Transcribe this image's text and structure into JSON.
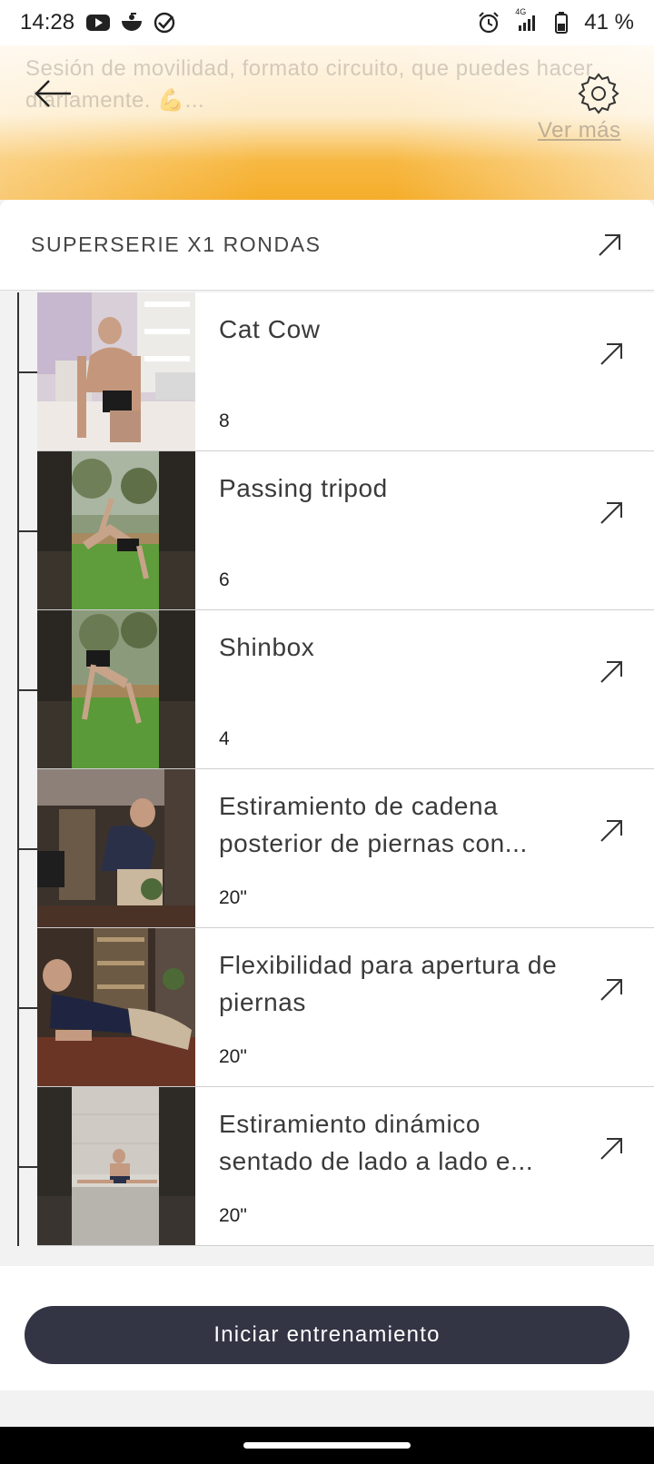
{
  "status_bar": {
    "time": "14:28",
    "network": "4G",
    "battery": "41 %",
    "icons": [
      "youtube-icon",
      "app-bowl-icon",
      "check-circle-icon",
      "alarm-icon",
      "signal-icon",
      "battery-icon"
    ]
  },
  "header": {
    "description": "Sesión de movilidad, formato circuito, que puedes hacer diariamente. 💪...",
    "see_more": "Ver más",
    "colors": {
      "gradient_top": "#fff6e8",
      "gradient_bottom": "#f5ad2a"
    }
  },
  "superserie": {
    "title": "SUPERSERIE X1 RONDAS"
  },
  "exercises": [
    {
      "name": "Cat Cow",
      "reps": "8",
      "thumb": "indoor-kitchen"
    },
    {
      "name": "Passing tripod",
      "reps": "6",
      "thumb": "outdoor-grass"
    },
    {
      "name": "Shinbox",
      "reps": "4",
      "thumb": "outdoor-grass"
    },
    {
      "name": "Estiramiento de cadena posterior de piernas con...",
      "reps": "20\"",
      "thumb": "indoor-dark"
    },
    {
      "name": "Flexibilidad para apertura de piernas",
      "reps": "20\"",
      "thumb": "indoor-wood"
    },
    {
      "name": "Estiramiento dinámico sentado de lado a lado e...",
      "reps": "20\"",
      "thumb": "outdoor-wall"
    }
  ],
  "footer": {
    "start_button": "Iniciar entrenamiento",
    "button_color": "#333545"
  }
}
